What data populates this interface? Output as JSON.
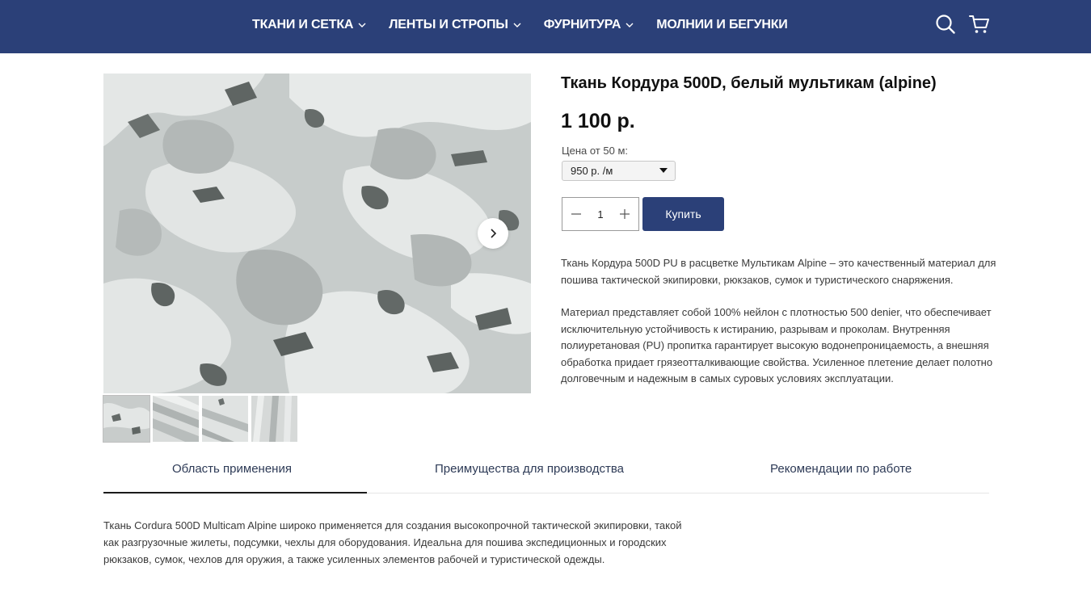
{
  "header": {
    "nav": [
      {
        "label": "ТКАНИ И СЕТКА",
        "has_dropdown": true
      },
      {
        "label": "ЛЕНТЫ И СТРОПЫ",
        "has_dropdown": true
      },
      {
        "label": "ФУРНИТУРА",
        "has_dropdown": true
      },
      {
        "label": "МОЛНИИ И БЕГУНКИ",
        "has_dropdown": false
      }
    ],
    "icons": [
      "search-icon",
      "cart-icon"
    ]
  },
  "colors": {
    "brand": "#2b4078",
    "text": "#1a1a1a",
    "muted": "#3a3a3a"
  },
  "gallery": {
    "main_image": "camo-fabric-multicam-alpine",
    "thumb_count": 4,
    "active_thumb": 0,
    "next_icon": "chevron-right-icon"
  },
  "product": {
    "title": "Ткань Кордура 500D, белый мультикам (alpine)",
    "price": "1 100 р.",
    "price_from_label": "Цена от 50 м:",
    "price_from_value": "950 р. /м",
    "quantity": "1",
    "buy_label": "Купить",
    "description": [
      "Ткань Кордура 500D PU в расцветке Мультикам Alpine – это качественный материал для пошива тактической экипировки, рюкзаков, сумок и туристического снаряжения.",
      "Материал представляет собой 100% нейлон с плотностью 500 denier, что обеспечивает исключительную устойчивость к истиранию, разрывам и проколам. Внутренняя полиуретановая (PU) пропитка гарантирует высокую водонепроницаемость, а внешняя обработка придает грязеотталкивающие свойства. Усиленное плетение делает полотно долговечным и надежным в самых суровых условиях эксплуатации."
    ]
  },
  "tabs": {
    "items": [
      {
        "label": "Область применения",
        "active": true
      },
      {
        "label": "Преимущества для производства",
        "active": false
      },
      {
        "label": "Рекомендации по работе",
        "active": false
      }
    ],
    "active_content": "Ткань Cordura 500D Multicam Alpine широко применяется для создания высокопрочной тактической экипировки, такой как разгрузочные жилеты, подсумки, чехлы для оборудования. Идеальна для пошива экспедиционных и городских рюкзаков, сумок, чехлов для оружия, а также усиленных элементов рабочей и туристической одежды."
  }
}
